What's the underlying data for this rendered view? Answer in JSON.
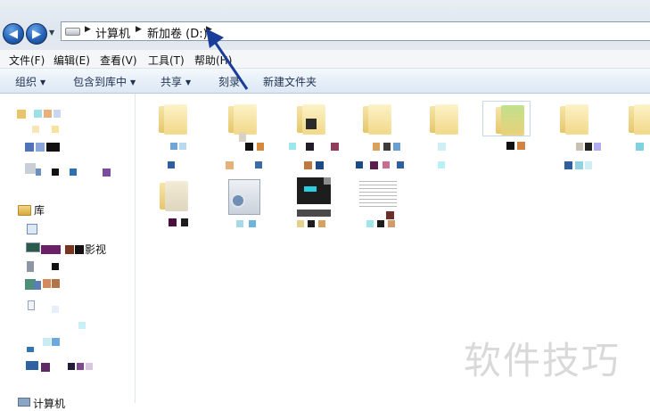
{
  "address": {
    "breadcrumbs": [
      "计算机",
      "新加卷 (D:)"
    ],
    "icons": {
      "back": "back-arrow-icon",
      "forward": "forward-arrow-icon",
      "drive": "drive-icon"
    }
  },
  "menubar": {
    "items": [
      "文件(F)",
      "编辑(E)",
      "查看(V)",
      "工具(T)",
      "帮助(H)"
    ]
  },
  "toolbar": {
    "organize": "组织",
    "include_in_library": "包含到库中",
    "share": "共享",
    "burn": "刻录",
    "new_folder": "新建文件夹"
  },
  "navpane": {
    "libraries_label": "库",
    "videos_label_tail": "影视",
    "computer_label": "计算机"
  },
  "watermark": {
    "text": "软件技巧"
  },
  "colors": {
    "accent_blue": "#2461b5",
    "annotation_arrow": "#1a3c9a",
    "folder_yellow": "#f2d98a"
  }
}
